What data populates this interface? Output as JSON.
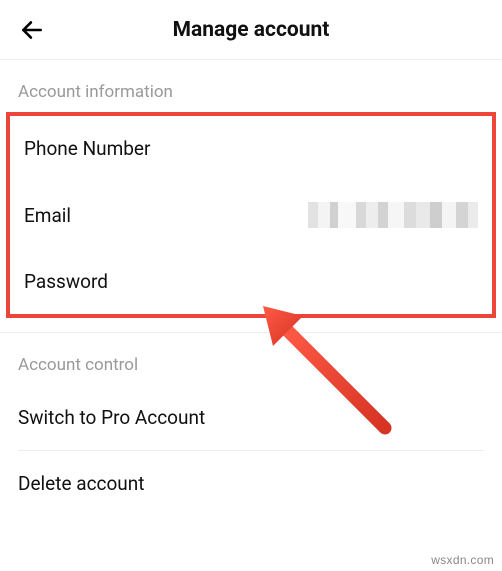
{
  "header": {
    "title": "Manage account"
  },
  "sections": {
    "info": {
      "header": "Account information",
      "phone": "Phone Number",
      "email": "Email",
      "password": "Password"
    },
    "control": {
      "header": "Account control",
      "switchPro": "Switch to Pro Account",
      "delete": "Delete account"
    }
  },
  "watermark": "wsxdn.com"
}
